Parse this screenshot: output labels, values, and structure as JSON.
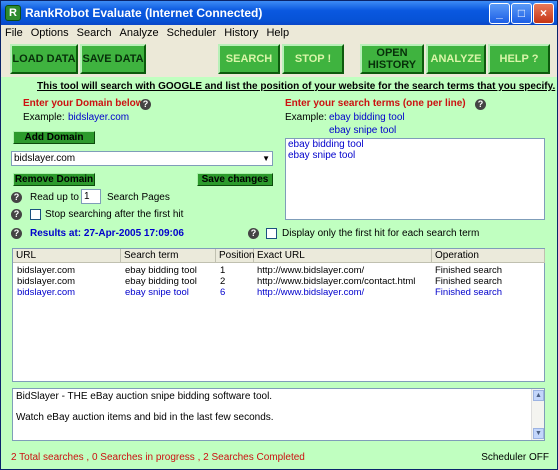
{
  "window": {
    "title": "RankRobot Evaluate (Internet Connected)",
    "controls": [
      "_",
      "□",
      "×"
    ]
  },
  "menu": [
    "File",
    "Options",
    "Search",
    "Analyze",
    "Scheduler",
    "History",
    "Help"
  ],
  "toolbar": {
    "load": "LOAD DATA",
    "save": "SAVE DATA",
    "search": "SEARCH",
    "stop": "STOP !",
    "open_history_1": "OPEN",
    "open_history_2": "HISTORY",
    "analyze": "ANALYZE",
    "help": "HELP ?"
  },
  "intro": "This tool will  search with GOOGLE  and list the position of your website for the search terms that you specify.",
  "domain": {
    "heading": "Enter your Domain below",
    "example_label": "Example:",
    "example_value": "bidslayer.com",
    "add_button": "Add Domain",
    "selected": "bidslayer.com",
    "remove_button": "Remove Domain",
    "save_button": "Save changes",
    "read_up_to": "Read up to",
    "pages_value": "1",
    "pages_label": "Search Pages",
    "stop_first_hit": "Stop searching after the first hit"
  },
  "terms": {
    "heading": "Enter your search terms  (one per line)",
    "example_label": "Example:",
    "example_1": "ebay bidding tool",
    "example_2": "ebay snipe tool",
    "entries": [
      "ebay bidding tool",
      "ebay snipe tool"
    ],
    "display_first_only": "Display only the first hit for each search term"
  },
  "results": {
    "label": "Results at:  27-Apr-2005 17:09:06",
    "columns": [
      "URL",
      "Search term",
      "Position",
      "Exact URL",
      "Operation"
    ],
    "rows": [
      {
        "url": "bidslayer.com",
        "term": "ebay bidding tool",
        "pos": "1",
        "exact": "http://www.bidslayer.com/",
        "op": "Finished search",
        "color": "#000000"
      },
      {
        "url": "bidslayer.com",
        "term": "ebay bidding tool",
        "pos": "2",
        "exact": "http://www.bidslayer.com/contact.html",
        "op": "Finished search",
        "color": "#000000"
      },
      {
        "url": "bidslayer.com",
        "term": "ebay snipe tool",
        "pos": "6",
        "exact": "http://www.bidslayer.com/",
        "op": "Finished search",
        "color": "#0000cc"
      }
    ]
  },
  "description": {
    "line1": "BidSlayer - THE eBay auction snipe bidding software tool.",
    "line2": "Watch eBay auction items and bid in the last few seconds."
  },
  "status": {
    "left": "2 Total searches , 0 Searches in progress , 2 Searches Completed",
    "right": "Scheduler OFF"
  },
  "colors": {
    "background": "#c0ffc0",
    "button_green": "#3fb33f",
    "label_red": "#cc1111",
    "link_blue": "#0000cc"
  }
}
